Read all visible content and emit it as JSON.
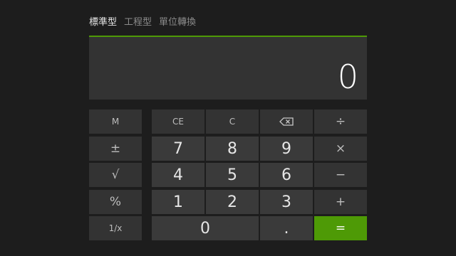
{
  "tabs": [
    {
      "label": "標準型",
      "active": true
    },
    {
      "label": "工程型",
      "active": false
    },
    {
      "label": "單位轉換",
      "active": false
    }
  ],
  "display": {
    "value": "0"
  },
  "memory_keys": {
    "m": "M",
    "plusminus": "±",
    "sqrt": "√",
    "percent": "%",
    "reciprocal": "1/x"
  },
  "keys": {
    "ce": "CE",
    "c": "C",
    "backspace_icon": "backspace-icon",
    "divide": "÷",
    "multiply": "×",
    "minus": "−",
    "plus": "+",
    "equals": "=",
    "decimal": ".",
    "n0": "0",
    "n1": "1",
    "n2": "2",
    "n3": "3",
    "n4": "4",
    "n5": "5",
    "n6": "6",
    "n7": "7",
    "n8": "8",
    "n9": "9"
  },
  "colors": {
    "accent": "#4e9a06",
    "background": "#1d1d1d",
    "key": "#333333"
  }
}
